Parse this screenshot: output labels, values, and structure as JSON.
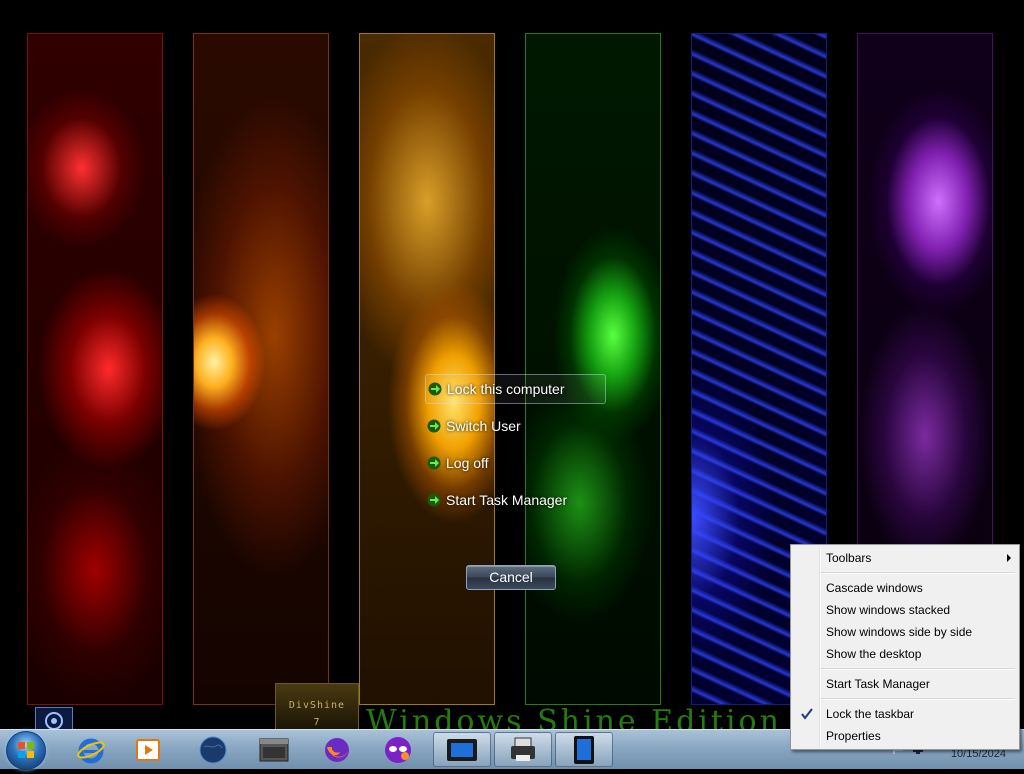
{
  "secure_options": {
    "items": [
      {
        "label": "Lock this computer"
      },
      {
        "label": "Switch User"
      },
      {
        "label": "Log off"
      },
      {
        "label": "Start Task Manager"
      }
    ],
    "cancel_label": "Cancel"
  },
  "desktop": {
    "widget_text": "DivShine",
    "widget_sub": "7",
    "wallpaper_text": "Windows Shine Edition"
  },
  "context_menu": {
    "items": [
      {
        "label": "Toolbars",
        "has_submenu": true
      },
      {
        "label": "Cascade windows"
      },
      {
        "label": "Show windows stacked"
      },
      {
        "label": "Show windows side by side"
      },
      {
        "label": "Show the desktop"
      },
      {
        "label": "Start Task Manager"
      },
      {
        "label": "Lock the taskbar",
        "checked": true
      },
      {
        "label": "Properties"
      }
    ]
  },
  "taskbar": {
    "pinned": [
      {
        "icon": "internet-explorer-icon"
      },
      {
        "icon": "media-player-icon"
      },
      {
        "icon": "globe-icon"
      },
      {
        "icon": "window-app-icon"
      },
      {
        "icon": "firefox-icon"
      },
      {
        "icon": "mask-app-icon"
      },
      {
        "icon": "virtual-machine-icon"
      },
      {
        "icon": "printer-icon"
      },
      {
        "icon": "tablet-icon"
      }
    ],
    "clock_date": "10/15/2024"
  }
}
